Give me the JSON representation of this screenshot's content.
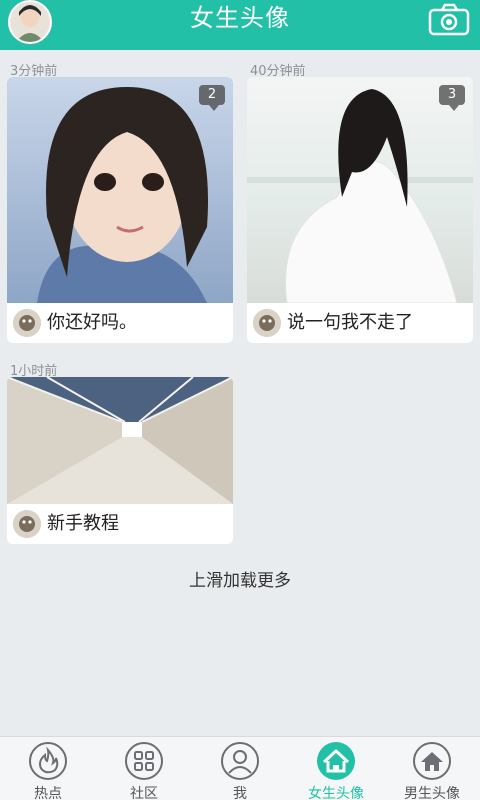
{
  "header": {
    "title": "女生头像",
    "avatar_icon": "user-avatar",
    "camera_icon": "camera-icon",
    "color": "#22c0a6"
  },
  "posts": [
    {
      "time": "3分钟前",
      "caption": "你还好吗。",
      "comment_count": "2"
    },
    {
      "time": "40分钟前",
      "caption": "说一句我不走了",
      "comment_count": "3"
    },
    {
      "time": "1小时前",
      "caption": "新手教程",
      "comment_count": ""
    }
  ],
  "load_more": "上滑加载更多",
  "tabs": [
    {
      "label": "热点",
      "icon": "fire-icon"
    },
    {
      "label": "社区",
      "icon": "grid-icon"
    },
    {
      "label": "我",
      "icon": "person-icon"
    },
    {
      "label": "女生头像",
      "icon": "home-icon",
      "active": true
    },
    {
      "label": "男生头像",
      "icon": "home-icon"
    }
  ],
  "accent": "#22c0a6"
}
